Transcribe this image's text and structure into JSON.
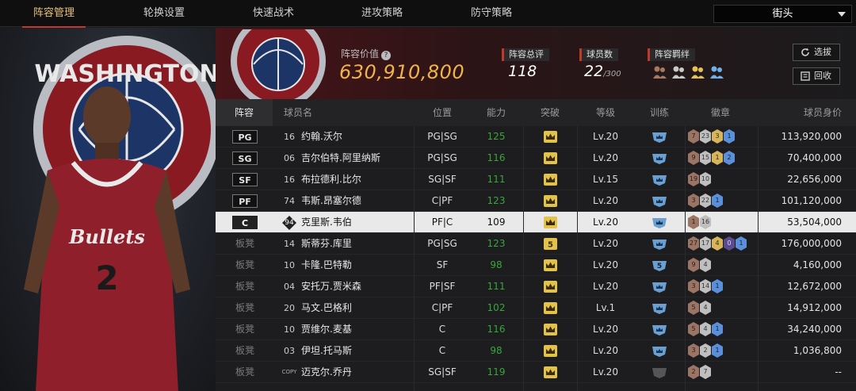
{
  "nav": {
    "tabs": [
      {
        "label": "阵容管理",
        "active": true
      },
      {
        "label": "轮换设置",
        "active": false
      },
      {
        "label": "快速战术",
        "active": false
      },
      {
        "label": "进攻策略",
        "active": false
      },
      {
        "label": "防守策略",
        "active": false
      }
    ],
    "mode_select": "街头"
  },
  "header": {
    "lineup_value_label": "阵容价值",
    "lineup_value": "630,910,800",
    "overall_label": "阵容总评",
    "overall_value": "118",
    "player_count_label": "球员数",
    "player_count_value": "22",
    "player_count_max": "/300",
    "chemistry_label": "阵容羁绊",
    "chemistry_icons": [
      "bond-icon-bronze",
      "bond-icon-silver",
      "bond-icon-gold",
      "bond-icon-blue"
    ],
    "select_button": "选拔",
    "recycle_button": "回收"
  },
  "colors": {
    "accent_red": "#c0392b",
    "value_gold": "#f0b24a",
    "ability_green": "#37a73a",
    "crown_yellow": "#e3c24a",
    "train_blue": "#6a9fd0"
  },
  "table": {
    "columns": [
      "阵容",
      "球员名",
      "位置",
      "能力",
      "突破",
      "等级",
      "训练",
      "徽章",
      "球员身价"
    ],
    "rows": [
      {
        "slot": "PG",
        "starter": true,
        "number": "16",
        "name": "约翰.沃尔",
        "position": "PG|SG",
        "ability": "125",
        "breakthrough": "crown",
        "level": "Lv.20",
        "training": "crown",
        "badges": [
          [
            "bronze",
            "7"
          ],
          [
            "silver",
            "23"
          ],
          [
            "gold",
            "3"
          ],
          [
            "blue",
            "1"
          ]
        ],
        "salary": "113,920,000"
      },
      {
        "slot": "SG",
        "starter": true,
        "number": "06",
        "name": "吉尔伯特.阿里纳斯",
        "position": "PG|SG",
        "ability": "116",
        "breakthrough": "crown",
        "level": "Lv.20",
        "training": "crown",
        "badges": [
          [
            "bronze",
            "9"
          ],
          [
            "silver",
            "15"
          ],
          [
            "gold",
            "1"
          ],
          [
            "blue",
            "2"
          ]
        ],
        "salary": "70,400,000"
      },
      {
        "slot": "SF",
        "starter": true,
        "number": "16",
        "name": "布拉德利.比尔",
        "position": "SG|SF",
        "ability": "111",
        "breakthrough": "crown",
        "level": "Lv.15",
        "training": "crown",
        "badges": [
          [
            "bronze",
            "19"
          ],
          [
            "silver",
            "10"
          ]
        ],
        "salary": "22,656,000"
      },
      {
        "slot": "PF",
        "starter": true,
        "number": "74",
        "name": "韦斯.昂塞尔德",
        "position": "C|PF",
        "ability": "123",
        "breakthrough": "crown",
        "level": "Lv.20",
        "training": "crown",
        "badges": [
          [
            "bronze",
            "3"
          ],
          [
            "silver",
            "22"
          ],
          [
            "blue",
            "1"
          ]
        ],
        "salary": "101,120,000"
      },
      {
        "slot": "C",
        "starter": true,
        "selected": true,
        "number": "94",
        "name": "克里斯.韦伯",
        "position": "PF|C",
        "ability": "109",
        "breakthrough": "crown",
        "level": "Lv.20",
        "training": "crown",
        "badges": [
          [
            "bronze",
            "1"
          ],
          [
            "silver",
            "16"
          ]
        ],
        "salary": "53,504,000"
      },
      {
        "slot": "板凳",
        "starter": false,
        "number": "14",
        "name": "斯蒂芬.库里",
        "position": "PG|SG",
        "ability": "123",
        "breakthrough": "5",
        "level": "Lv.20",
        "training": "crown",
        "badges": [
          [
            "bronze",
            "27"
          ],
          [
            "silver",
            "17"
          ],
          [
            "gold",
            "4"
          ],
          [
            "purple",
            "0"
          ],
          [
            "blue",
            "1"
          ]
        ],
        "salary": "176,000,000"
      },
      {
        "slot": "板凳",
        "starter": false,
        "number": "10",
        "name": "卡隆.巴特勒",
        "position": "SF",
        "ability": "98",
        "breakthrough": "crown",
        "level": "Lv.20",
        "training": "5",
        "badges": [
          [
            "bronze",
            "9"
          ],
          [
            "silver",
            "4"
          ]
        ],
        "salary": "4,160,000"
      },
      {
        "slot": "板凳",
        "starter": false,
        "number": "04",
        "name": "安托万.贾米森",
        "position": "PF|SF",
        "ability": "111",
        "breakthrough": "crown",
        "level": "Lv.20",
        "training": "crown",
        "badges": [
          [
            "bronze",
            "3"
          ],
          [
            "silver",
            "14"
          ],
          [
            "blue",
            "1"
          ]
        ],
        "salary": "12,672,000"
      },
      {
        "slot": "板凳",
        "starter": false,
        "number": "20",
        "name": "马文.巴格利",
        "position": "C|PF",
        "ability": "102",
        "breakthrough": "crown",
        "level": "Lv.1",
        "training": "crown",
        "badges": [
          [
            "bronze",
            "5"
          ],
          [
            "silver",
            "4"
          ]
        ],
        "salary": "14,912,000"
      },
      {
        "slot": "板凳",
        "starter": false,
        "number": "10",
        "name": "贾维尔.麦基",
        "position": "C",
        "ability": "116",
        "breakthrough": "crown",
        "level": "Lv.20",
        "training": "crown",
        "badges": [
          [
            "bronze",
            "5"
          ],
          [
            "silver",
            "4"
          ],
          [
            "blue",
            "1"
          ]
        ],
        "salary": "34,240,000"
      },
      {
        "slot": "板凳",
        "starter": false,
        "number": "03",
        "name": "伊坦.托马斯",
        "position": "C",
        "ability": "98",
        "breakthrough": "crown",
        "level": "Lv.20",
        "training": "crown",
        "badges": [
          [
            "bronze",
            "3"
          ],
          [
            "silver",
            "2"
          ],
          [
            "blue",
            "1"
          ]
        ],
        "salary": "1,036,800"
      },
      {
        "slot": "板凳",
        "starter": false,
        "number": "COPY",
        "name": "迈克尔.乔丹",
        "position": "SG|SF",
        "ability": "119",
        "breakthrough": "crown",
        "level": "Lv.20",
        "training": "none",
        "badges": [
          [
            "bronze",
            "2"
          ],
          [
            "silver",
            "7"
          ]
        ],
        "salary": "--"
      }
    ]
  },
  "player_panel": {
    "team_logo_text": "WASHINGTON",
    "jersey_text": "Bullets",
    "jersey_number": "2"
  }
}
